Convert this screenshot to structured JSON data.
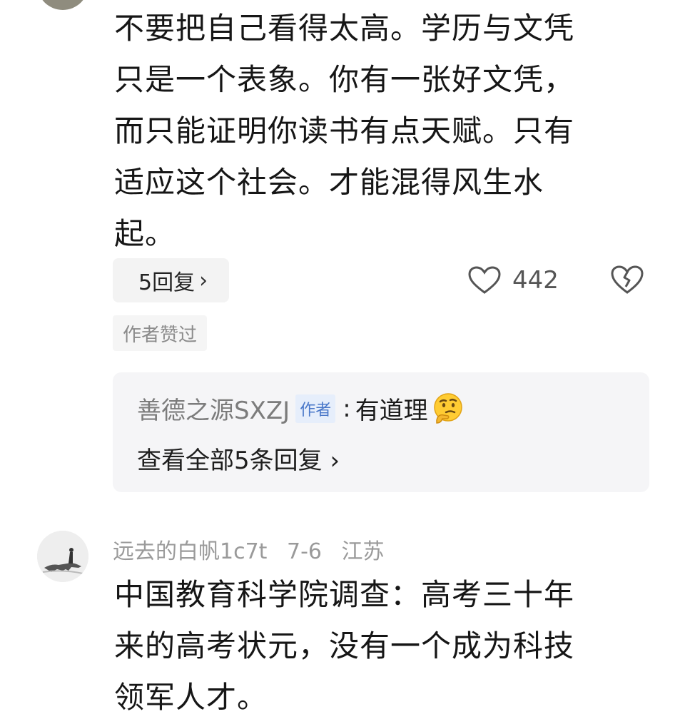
{
  "comment1": {
    "lines": [
      "不要把自己看得太高。学历与文凭",
      "只是一个表象。你有一张好文凭，",
      "而只能证明你读书有点天赋。只有",
      "适应这个社会。才能混得风生水",
      "起。"
    ],
    "replies_label": "5回复",
    "likes": "442",
    "author_liked_tag": "作者赞过",
    "preview_reply": {
      "user": "善德之源SXZJ",
      "badge": "作者",
      "colon": ":",
      "text": "有道理",
      "emoji_icon": "thinking-face"
    },
    "view_all_label": "查看全部5条回复"
  },
  "comment2": {
    "user": "远去的白帆1c7t",
    "date": "7-6",
    "location": "江苏",
    "lines": [
      "中国教育科学院调查：高考三十年",
      "来的高考状元，没有一个成为科技",
      "领军人才。"
    ]
  }
}
